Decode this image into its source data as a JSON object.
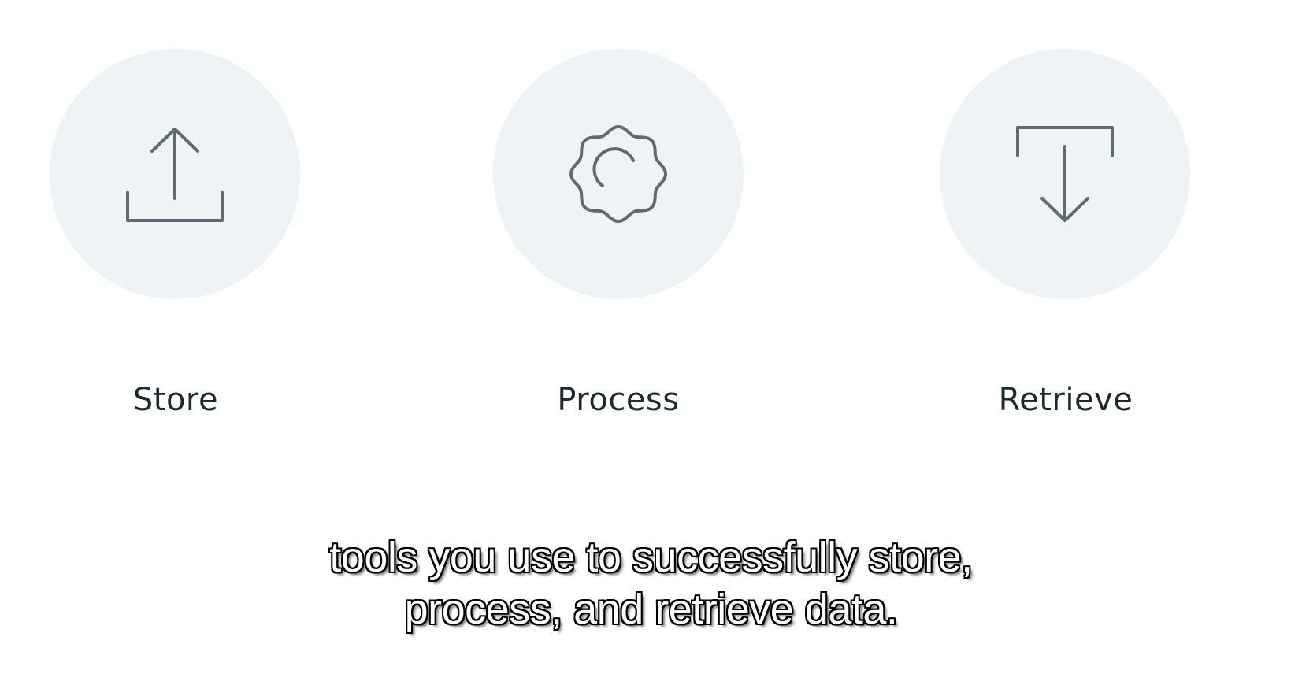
{
  "colors": {
    "background": "#ffffff",
    "circle_fill": "#eef3f5",
    "icon_stroke": "#5f6b73",
    "label_text": "#1c2b33",
    "caption_text": "#ffffff",
    "caption_outline": "#000000"
  },
  "steps": [
    {
      "label": "Store",
      "icon": "upload-icon"
    },
    {
      "label": "Process",
      "icon": "gear-icon"
    },
    {
      "label": "Retrieve",
      "icon": "download-icon"
    }
  ],
  "caption": {
    "line1": "tools you use to successfully store,",
    "line2": "process, and retrieve data."
  }
}
